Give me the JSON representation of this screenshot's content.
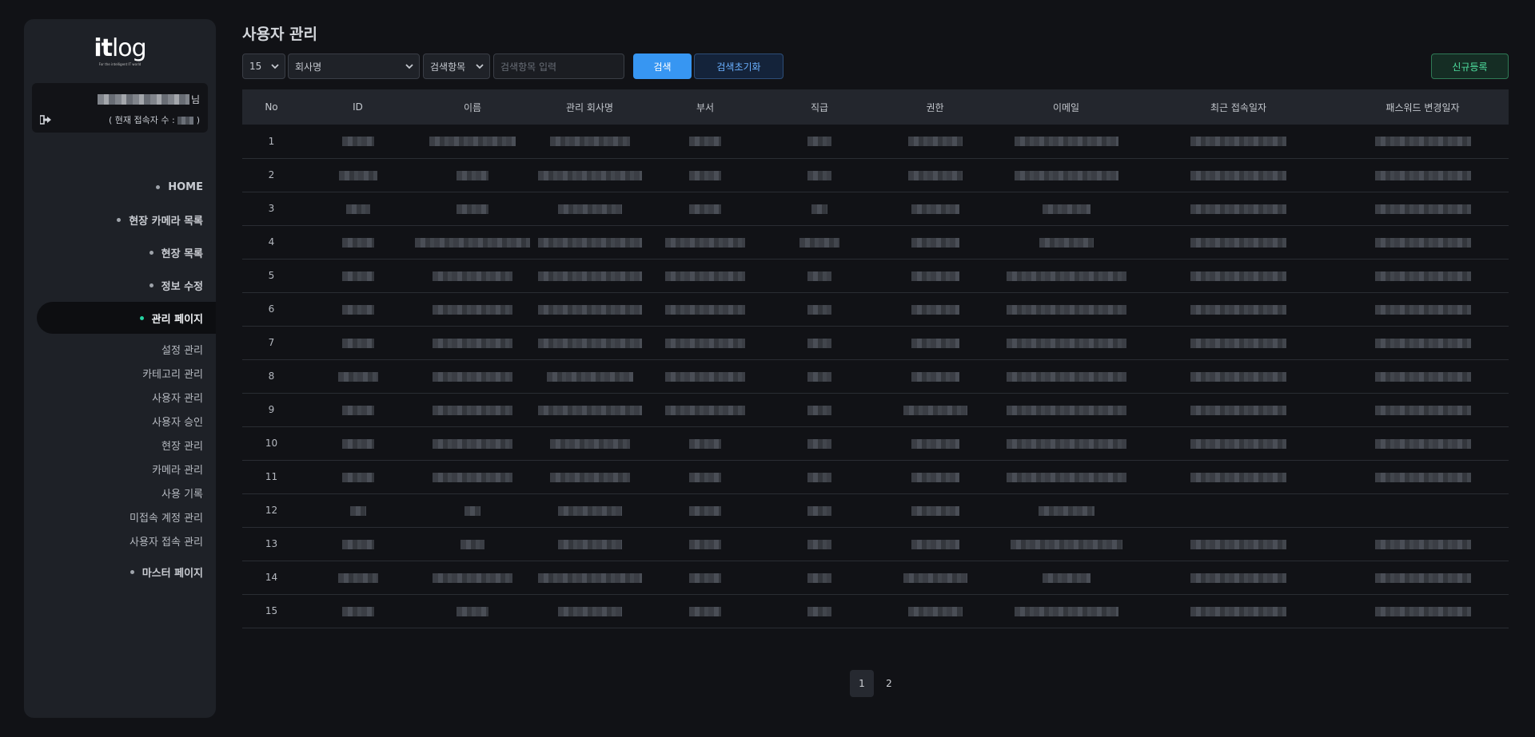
{
  "sidebar": {
    "logo_main_a": "it",
    "logo_main_b": "log",
    "logo_sub": "For the intelligent IT world",
    "user_suffix": "님",
    "status_prefix": "( 현재 접속자 수 :",
    "status_suffix": ")",
    "menu": [
      {
        "label": "HOME"
      },
      {
        "label": "현장 카메라 목록"
      },
      {
        "label": "현장 목록"
      },
      {
        "label": "정보 수정"
      },
      {
        "label": "관리 페이지"
      }
    ],
    "submenu": [
      {
        "label": "설정 관리"
      },
      {
        "label": "카테고리 관리"
      },
      {
        "label": "사용자 관리"
      },
      {
        "label": "사용자 승인"
      },
      {
        "label": "현장 관리"
      },
      {
        "label": "카메라 관리"
      },
      {
        "label": "사용 기록"
      },
      {
        "label": "미접속 계정 관리"
      },
      {
        "label": "사용자 접속 관리"
      }
    ],
    "master": "마스터 페이지"
  },
  "page_title": "사용자 관리",
  "toolbar": {
    "page_size": "15",
    "company_select": "회사명",
    "search_field_select": "검색항목",
    "search_placeholder": "검색항목 입력",
    "search_label": "검색",
    "reset_label": "검색초기화",
    "new_label": "신규등록"
  },
  "table": {
    "headers": [
      "No",
      "ID",
      "이름",
      "관리 회사명",
      "부서",
      "직급",
      "권한",
      "이메일",
      "최근 접속일자",
      "패스워드 변경일자"
    ],
    "rows": [
      {
        "no": "1"
      },
      {
        "no": "2"
      },
      {
        "no": "3"
      },
      {
        "no": "4"
      },
      {
        "no": "5"
      },
      {
        "no": "6"
      },
      {
        "no": "7"
      },
      {
        "no": "8"
      },
      {
        "no": "9"
      },
      {
        "no": "10"
      },
      {
        "no": "11"
      },
      {
        "no": "12"
      },
      {
        "no": "13"
      },
      {
        "no": "14"
      },
      {
        "no": "15"
      }
    ]
  },
  "pagination": {
    "pages": [
      "1",
      "2"
    ],
    "current": "1"
  }
}
